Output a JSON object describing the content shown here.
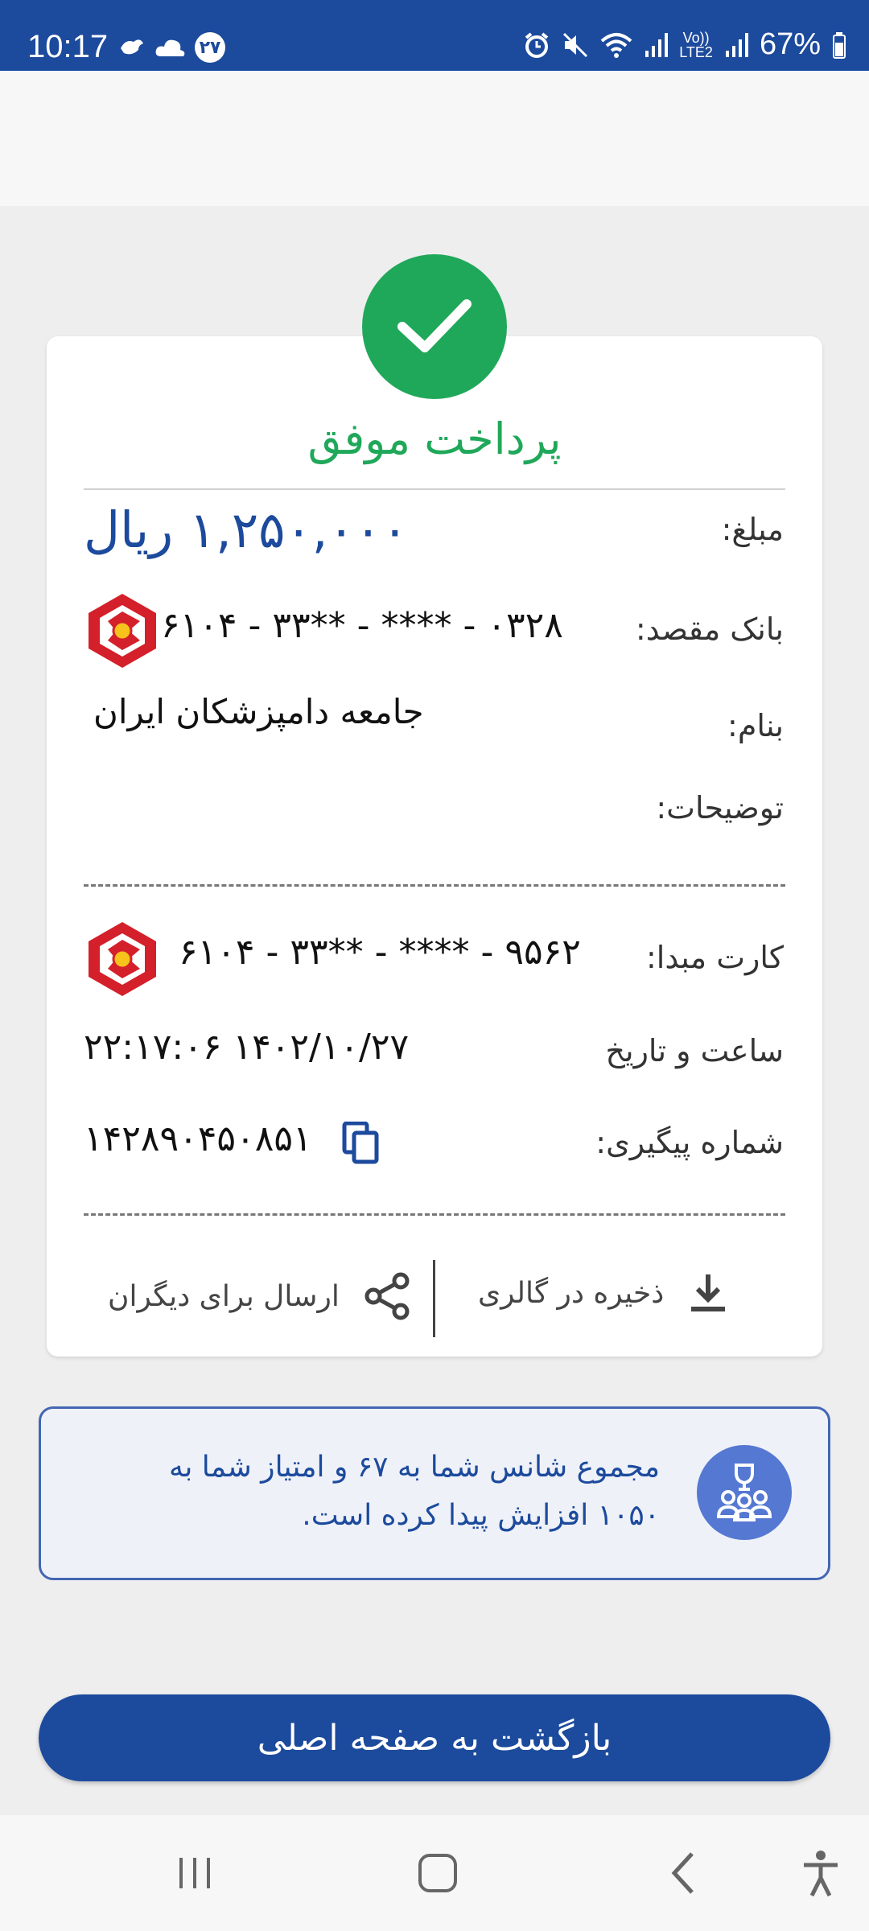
{
  "status_bar": {
    "time": "10:17",
    "badge": "۲۷",
    "battery": "67%",
    "network": "LTE2",
    "volte": "Vo))"
  },
  "receipt": {
    "title": "پرداخت موفق",
    "amount_label": "مبلغ:",
    "amount_value": "۱,۲۵۰,۰۰۰ ریال",
    "dest_bank_label": "بانک مقصد:",
    "dest_card": "۶۱۰۴ - ۳۳** - **** - ۰۳۲۸",
    "name_label": "بنام:",
    "name_value": "جامعه دامپزشکان ایران",
    "desc_label": "توضیحات:",
    "source_card_label": "کارت مبدا:",
    "source_card": "۶۱۰۴ - ۳۳** - **** - ۹۵۶۲",
    "datetime_label": "ساعت و تاریخ",
    "datetime_value": "۲۲:۱۷:۰۶ ۱۴۰۲/۱۰/۲۷",
    "tracking_label": "شماره پیگیری:",
    "tracking_value": "۱۴۲۸۹۰۴۵۰۸۵۱",
    "save_label": "ذخیره در گالری",
    "share_label": "ارسال برای دیگران"
  },
  "score": {
    "line1": "مجموع شانس شما به ۶۷ و امتیاز شما به",
    "line2": "۱۰۵۰ افزایش پیدا کرده است."
  },
  "home_button_label": "بازگشت به صفحه اصلی",
  "colors": {
    "primary": "#1c4a9c",
    "success": "#20a85a",
    "bank_red": "#d4202a",
    "score_icon": "#5578d2"
  }
}
